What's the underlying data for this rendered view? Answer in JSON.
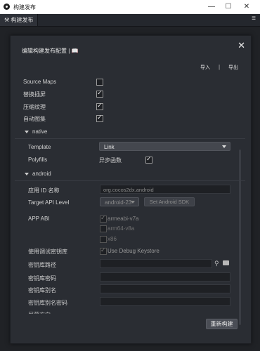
{
  "window": {
    "title": "构建发布",
    "minimize": "—",
    "maximize": "☐",
    "close": "✕"
  },
  "tab": {
    "label": "构建发布",
    "menu_icon": "≡"
  },
  "dialog": {
    "title": "编辑构建发布配置 |",
    "import": "导入",
    "separator": "|",
    "export": "导出",
    "close": "✕"
  },
  "options": {
    "source_maps": {
      "label": "Source Maps",
      "checked": false
    },
    "replace_splash": {
      "label": "替换插屏",
      "checked": true
    },
    "compress_texture": {
      "label": "压缩纹理",
      "checked": true
    },
    "auto_atlas": {
      "label": "自动图集",
      "checked": true
    }
  },
  "native": {
    "section": "native",
    "template_label": "Template",
    "template_value": "Link",
    "polyfills_label": "Polyfills",
    "async_label": "异步函数",
    "async_checked": true
  },
  "android": {
    "section": "android",
    "app_id_label": "应用 ID 名称",
    "app_id_value": "org.cocos2dx.android",
    "api_label": "Target API Level",
    "api_value": "android-23",
    "set_sdk": "Set Android SDK",
    "abi_label": "APP ABI",
    "abis": [
      {
        "name": "armeabi-v7a",
        "checked": true
      },
      {
        "name": "arm64-v8a",
        "checked": false
      },
      {
        "name": "x86",
        "checked": false
      }
    ],
    "debug_keystore_label": "使用调试密钥库",
    "debug_keystore_option": "Use Debug Keystore",
    "keystore_path_label": "密钥库路径",
    "keystore_password_label": "密钥库密码",
    "alias_label": "密钥库别名",
    "alias_password_label": "密钥库别名密码",
    "screen_label": "屏幕方向"
  },
  "footer": {
    "rebuild": "重新构建"
  }
}
